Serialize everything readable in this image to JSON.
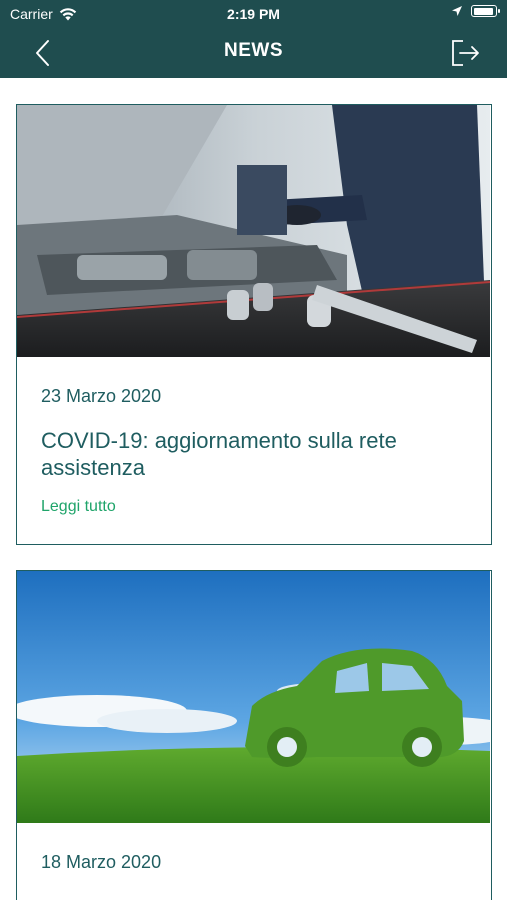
{
  "status_bar": {
    "carrier": "Carrier",
    "time": "2:19 PM",
    "icons": [
      "wifi-icon",
      "location-arrow-icon",
      "battery-icon"
    ]
  },
  "nav": {
    "title": "NEWS",
    "back_icon": "chevron-left-icon",
    "logout_icon": "logout-icon"
  },
  "colors": {
    "header_bg": "#1f4d4f",
    "accent_teal": "#1f5d60",
    "link_green": "#1fa46a"
  },
  "news": [
    {
      "image": "mechanic-tools-photo",
      "date": "23 Marzo 2020",
      "title": "COVID-19: aggiornamento sulla rete assistenza",
      "read_more": "Leggi tutto"
    },
    {
      "image": "green-leaf-car-photo",
      "date": "18 Marzo 2020"
    }
  ]
}
